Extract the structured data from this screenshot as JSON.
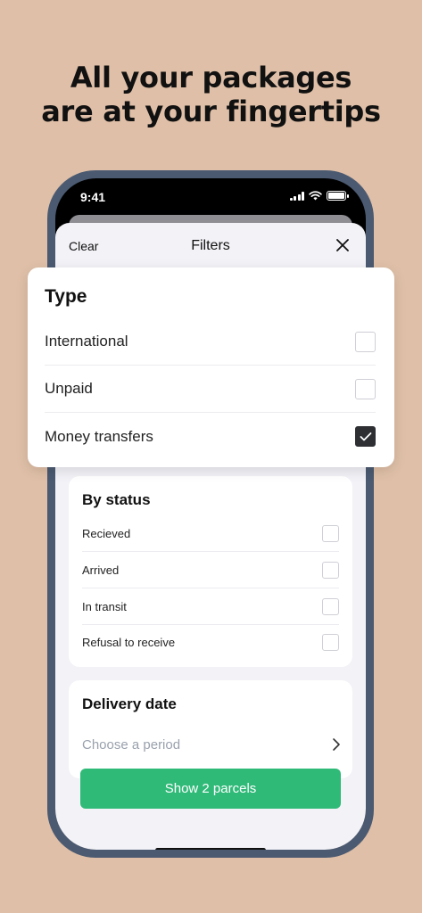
{
  "promo": {
    "headline_line1": "All your packages",
    "headline_line2": "are at your fingertips"
  },
  "status_bar": {
    "time": "9:41",
    "icons": [
      "cellular-signal-icon",
      "wifi-icon",
      "battery-icon"
    ]
  },
  "header": {
    "clear_label": "Clear",
    "title": "Filters",
    "close_icon": "close-icon"
  },
  "type_filter": {
    "title": "Type",
    "options": [
      {
        "label": "International",
        "checked": false
      },
      {
        "label": "Unpaid",
        "checked": false
      },
      {
        "label": "Money transfers",
        "checked": true
      }
    ]
  },
  "status_filter": {
    "title": "By status",
    "options": [
      {
        "label": "Recieved",
        "checked": false
      },
      {
        "label": "Arrived",
        "checked": false
      },
      {
        "label": "In transit",
        "checked": false
      },
      {
        "label": "Refusal to receive",
        "checked": false
      }
    ]
  },
  "delivery_date": {
    "title": "Delivery date",
    "placeholder": "Choose a period",
    "chevron_icon": "chevron-right-icon"
  },
  "action": {
    "show_label": "Show 2 parcels"
  },
  "colors": {
    "background": "#dfbfa7",
    "phone_frame": "#4b5a71",
    "accent_green": "#2fba78",
    "checked_box": "#2d2f33"
  }
}
